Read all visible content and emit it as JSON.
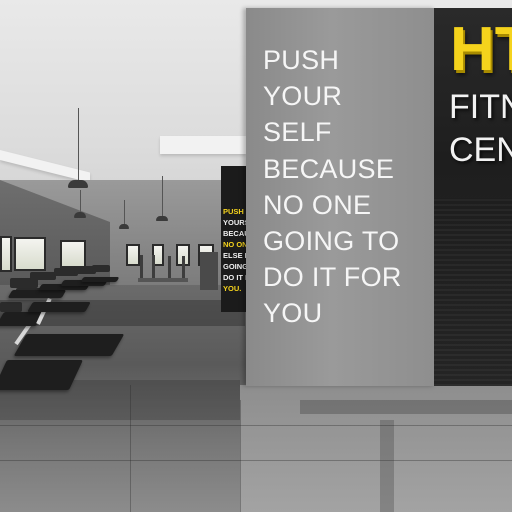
{
  "wall_quote": {
    "lines": [
      "PUSH",
      "YOUR",
      "SELF",
      "BECAUSE",
      "NO ONE",
      "GOING TO",
      "DO IT FOR",
      "YOU"
    ]
  },
  "pillar_poster": {
    "lines": [
      "PUSH",
      "YOURS",
      "BECAU",
      "NO ONE",
      "ELSE IS",
      "GOING",
      "DO IT F",
      "YOU."
    ],
    "highlight_color": "#f5d31c"
  },
  "brand_sign": {
    "logo_text": "HT",
    "subtitle_lines": [
      "FITN",
      "CEN"
    ],
    "logo_color": "#f5d31c"
  },
  "colors": {
    "wall_grey": "#8e8e8e",
    "sign_dark": "#222222",
    "floor_dark": "#5a5a5a"
  }
}
